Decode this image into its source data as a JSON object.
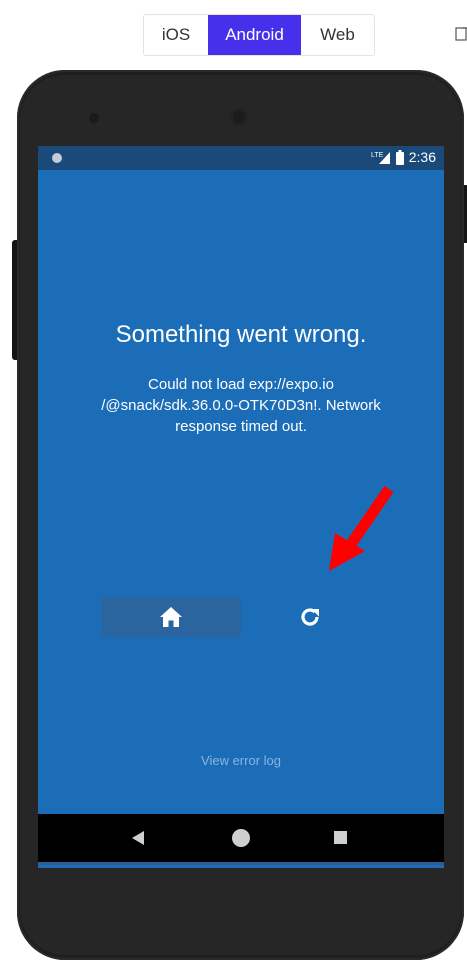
{
  "platform_tabs": {
    "items": [
      {
        "label": "iOS"
      },
      {
        "label": "Android",
        "selected": true
      },
      {
        "label": "Web"
      }
    ],
    "accent_color": "#4630eb"
  },
  "status_bar": {
    "network": "LTE",
    "time": "2:36"
  },
  "error": {
    "title": "Something went wrong.",
    "message": "Could not load exp://expo.io /@snack/sdk.36.0.0-OTK70D3n!. Network response timed out."
  },
  "actions": {
    "home_icon": "home-icon",
    "reload_icon": "reload-icon"
  },
  "footer": {
    "view_error_log": "View error log"
  },
  "nav_bar": {
    "back_icon": "back-icon",
    "home_icon": "circle-home-icon",
    "recent_icon": "recent-apps-icon"
  },
  "colors": {
    "screen_background": "#1c6db8",
    "annotation_arrow": "#ff0000"
  }
}
